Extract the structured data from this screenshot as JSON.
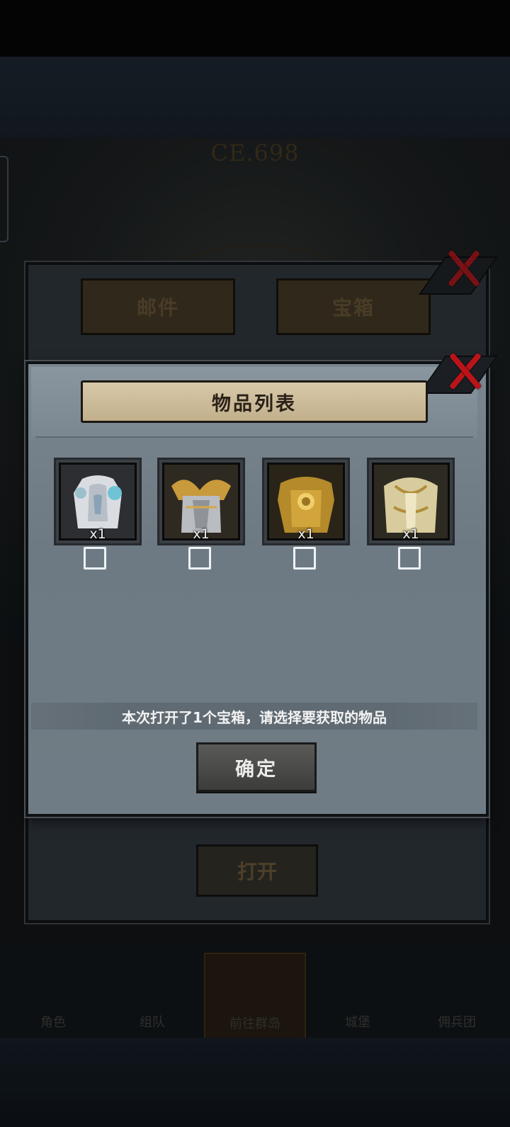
{
  "background": {
    "ce_label": "CE.698",
    "mail_tabs": [
      {
        "label": "邮件"
      },
      {
        "label": "宝箱"
      }
    ],
    "open_button": "打开",
    "bottom_nav": [
      {
        "label": "角色"
      },
      {
        "label": "组队"
      },
      {
        "label": "前往群岛"
      },
      {
        "label": "城堡"
      },
      {
        "label": "佣兵团"
      }
    ]
  },
  "modal": {
    "title": "物品列表",
    "items": [
      {
        "name": "white-blue-armor",
        "quantity": "x1",
        "checked": false
      },
      {
        "name": "silver-gold-winged-armor",
        "quantity": "x1",
        "checked": false
      },
      {
        "name": "golden-sun-armor",
        "quantity": "x1",
        "checked": false
      },
      {
        "name": "golden-white-armor",
        "quantity": "x1",
        "checked": false
      }
    ],
    "info_text": "本次打开了1个宝箱，请选择要获取的物品",
    "confirm_label": "确定"
  },
  "colors": {
    "close_x": "#b8141a",
    "title_plate": "#d7c8a8",
    "panel": "#7b8790"
  }
}
